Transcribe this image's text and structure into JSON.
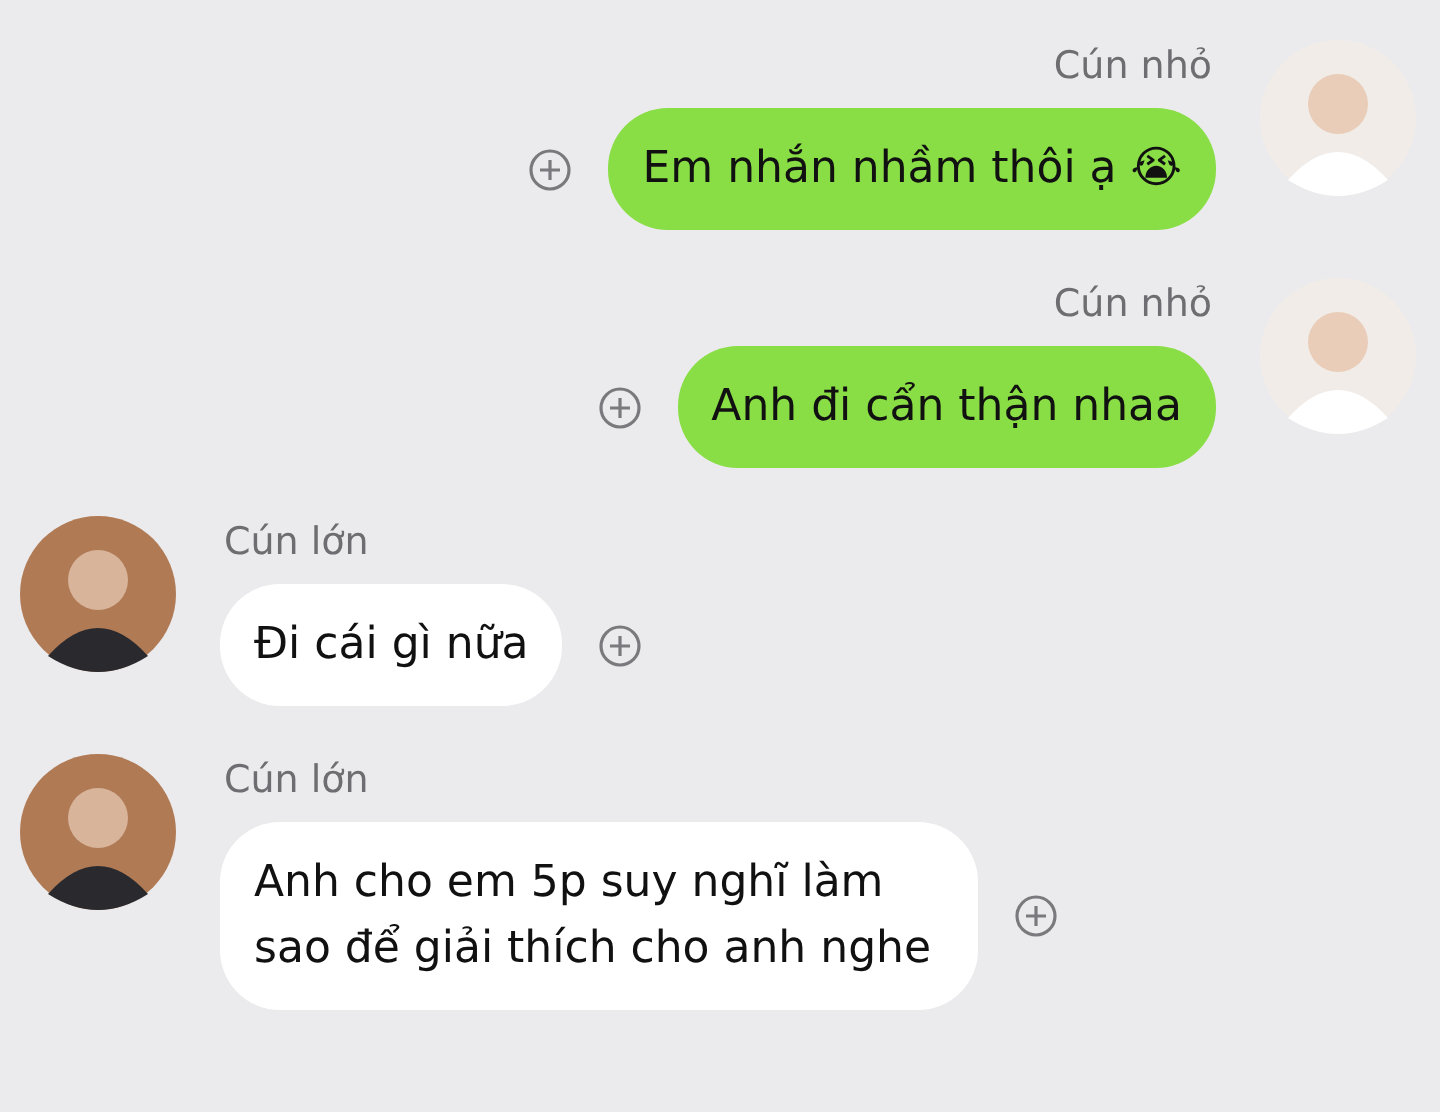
{
  "messages": [
    {
      "kind": "outgoing",
      "sender": "Cún nhỏ",
      "text": "Em nhắn nhầm thôi ạ 😭"
    },
    {
      "kind": "outgoing",
      "sender": "Cún nhỏ",
      "text": "Anh đi cẩn thận nhaa"
    },
    {
      "kind": "incoming",
      "sender": "Cún lớn",
      "text": "Đi cái gì nữa"
    },
    {
      "kind": "incoming",
      "sender": "Cún lớn",
      "text": "Anh cho em 5p suy nghĩ làm sao để giải thích cho anh nghe"
    }
  ]
}
